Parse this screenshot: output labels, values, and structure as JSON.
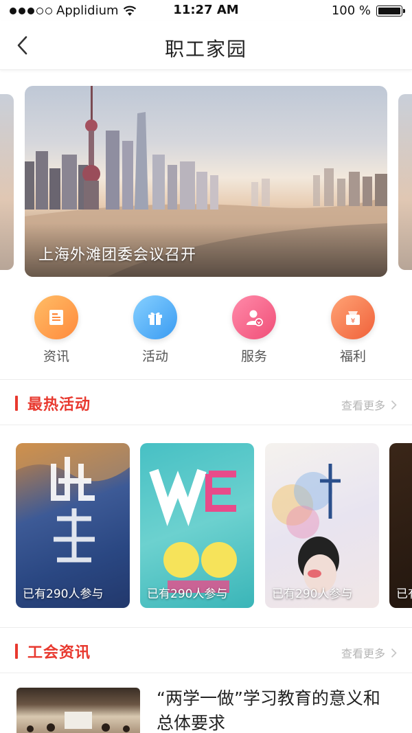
{
  "status_bar": {
    "carrier": "Applidium",
    "time": "11:27 AM",
    "battery": "100 %"
  },
  "nav": {
    "title": "职工家园",
    "back_icon": "chevron-left-icon"
  },
  "banner": {
    "caption": "上海外滩团委会议召开"
  },
  "quick_menu": [
    {
      "label": "资讯",
      "icon": "news-icon",
      "color_from": "#ffb35c",
      "color_to": "#ff8a3d"
    },
    {
      "label": "活动",
      "icon": "gift-icon",
      "color_from": "#7cc8ff",
      "color_to": "#3a9bf2"
    },
    {
      "label": "服务",
      "icon": "service-user-icon",
      "color_from": "#ff7fa0",
      "color_to": "#f04f78"
    },
    {
      "label": "福利",
      "icon": "welfare-bag-icon",
      "color_from": "#ff9a6a",
      "color_to": "#f0613a"
    }
  ],
  "hot_activities": {
    "title": "最热活动",
    "more": "查看更多",
    "cards": [
      {
        "caption": "已有290人参与"
      },
      {
        "caption": "已有290人参与"
      },
      {
        "caption": "已有290人参与"
      },
      {
        "caption": "已有"
      }
    ]
  },
  "union_news": {
    "title": "工会资讯",
    "more": "查看更多",
    "items": [
      {
        "title": "“两学一做”学习教育的意义和总体要求"
      }
    ]
  },
  "colors": {
    "accent": "#e8392f",
    "muted": "#b5b5b5"
  }
}
